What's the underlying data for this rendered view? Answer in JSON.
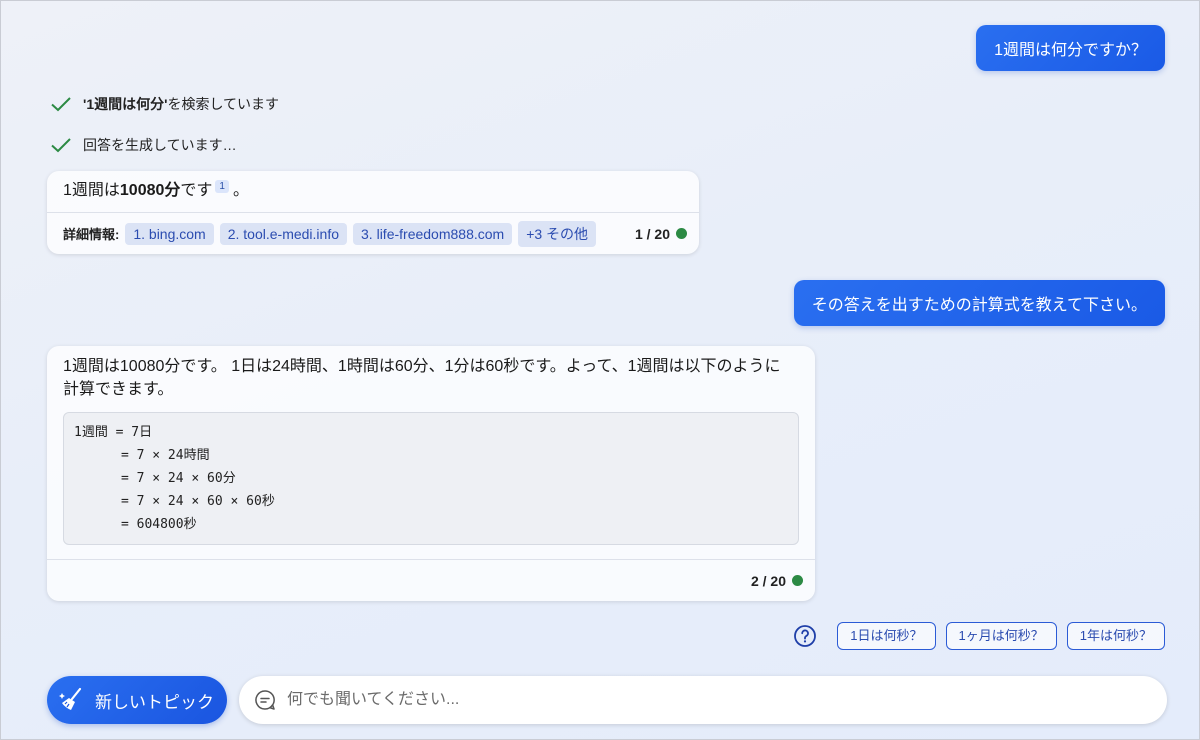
{
  "messages": {
    "user1": "1週間は何分ですか？",
    "status1": {
      "query": "'1週間は何分'",
      "suffix": " を検索しています"
    },
    "status2": "回答を生成しています…",
    "bot1": {
      "pre": "1週間は",
      "bold": "10080分",
      "post": "です",
      "cite": "1",
      "end": "。",
      "footer_label": "詳細情報:",
      "sources": [
        "1. bing.com",
        "2. tool.e-medi.info",
        "3. life-freedom888.com",
        "+3 その他"
      ],
      "page_count": "1 / 20"
    },
    "user2": "その答えを出すための計算式を教えて下さい。",
    "bot2": {
      "line1": "1週間は10080分です。 1日は24時間、1時間は60分、1分は60秒です。よって、1週間は以下のように",
      "line2": "計算できます。",
      "code_lines": [
        "1週間 = 7日",
        "      = 7 × 24時間",
        "      = 7 × 24 × 60分",
        "      = 7 × 24 × 60 × 60秒",
        "      = 604800秒"
      ],
      "page_count": "2 / 20"
    }
  },
  "suggestions": [
    "1日は何秒？",
    "1ヶ月は何秒？",
    "1年は何秒？"
  ],
  "new_topic_label": "新しいトピック",
  "input_placeholder": "何でも聞いてください...",
  "colors": {
    "accent": "#1a5ae6",
    "check": "#2c8a44",
    "chip_bg": "#dbe3f5",
    "chip_text": "#2b4cb0"
  },
  "icons": [
    "check-icon",
    "question-circle-icon",
    "broom-icon",
    "chat-bubble-icon"
  ]
}
